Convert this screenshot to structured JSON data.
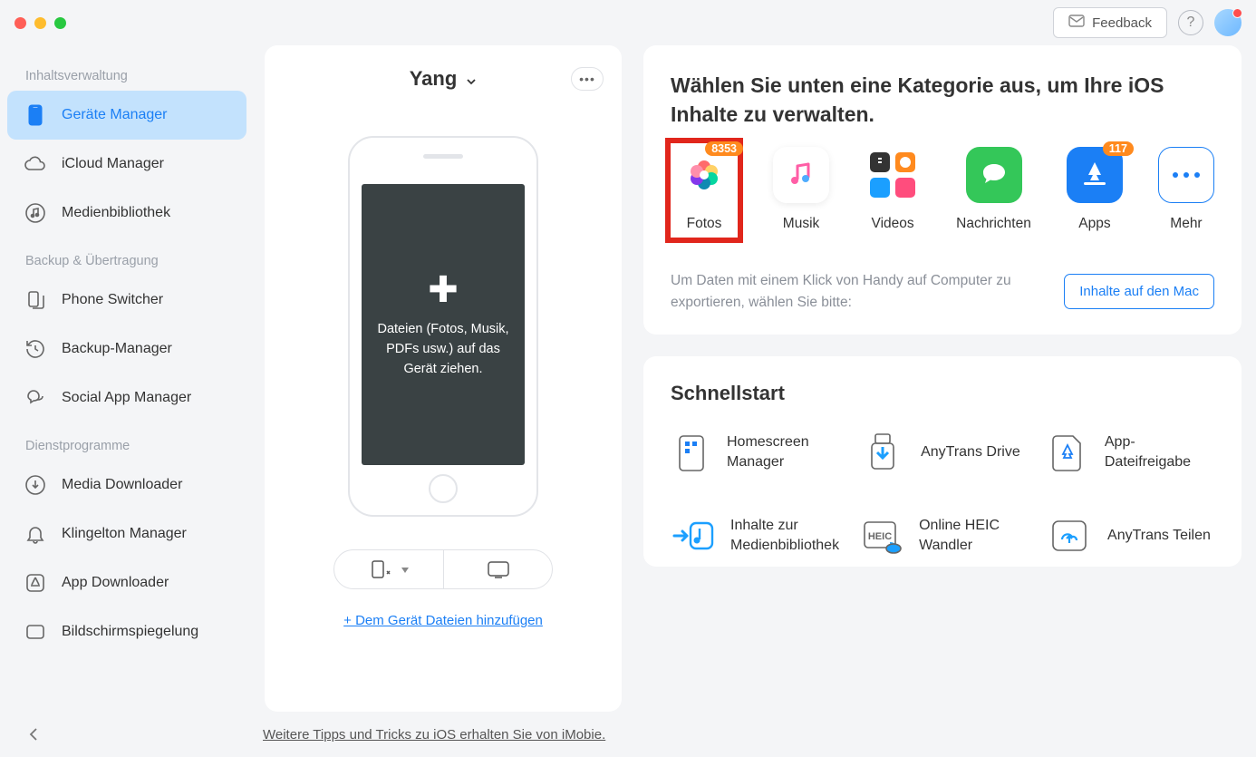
{
  "titlebar": {
    "feedback_label": "Feedback"
  },
  "sidebar": {
    "groups": [
      {
        "label": "Inhaltsverwaltung",
        "items": [
          {
            "label": "Geräte Manager"
          },
          {
            "label": "iCloud Manager"
          },
          {
            "label": "Medienbibliothek"
          }
        ]
      },
      {
        "label": "Backup & Übertragung",
        "items": [
          {
            "label": "Phone Switcher"
          },
          {
            "label": "Backup-Manager"
          },
          {
            "label": "Social App Manager"
          }
        ]
      },
      {
        "label": "Dienstprogramme",
        "items": [
          {
            "label": "Media Downloader"
          },
          {
            "label": "Klingelton Manager"
          },
          {
            "label": "App Downloader"
          },
          {
            "label": "Bildschirmspiegelung"
          }
        ]
      }
    ]
  },
  "device": {
    "name": "Yang",
    "drop_text": "Dateien (Fotos, Musik, PDFs usw.) auf das Gerät ziehen.",
    "add_link": "+ Dem Gerät Dateien hinzufügen"
  },
  "categories": {
    "title": "Wählen Sie unten eine Kategorie aus, um Ihre iOS Inhalte zu verwalten.",
    "items": [
      {
        "label": "Fotos",
        "badge": "8353"
      },
      {
        "label": "Musik",
        "badge": null
      },
      {
        "label": "Videos",
        "badge": null
      },
      {
        "label": "Nachrichten",
        "badge": null
      },
      {
        "label": "Apps",
        "badge": "117"
      },
      {
        "label": "Mehr",
        "badge": null
      }
    ],
    "export_text": "Um Daten mit einem Klick von Handy auf Computer zu exportieren, wählen Sie bitte:",
    "export_button": "Inhalte auf den Mac"
  },
  "quickstart": {
    "title": "Schnellstart",
    "items": [
      {
        "label": "Homescreen Manager"
      },
      {
        "label": "AnyTrans Drive"
      },
      {
        "label": "App-Dateifreigabe"
      },
      {
        "label": "Inhalte zur Medienbibliothek"
      },
      {
        "label": "Online HEIC Wandler"
      },
      {
        "label": "AnyTrans Teilen"
      }
    ]
  },
  "footer": {
    "tips_link": "Weitere Tipps und Tricks zu iOS erhalten Sie von iMobie."
  }
}
